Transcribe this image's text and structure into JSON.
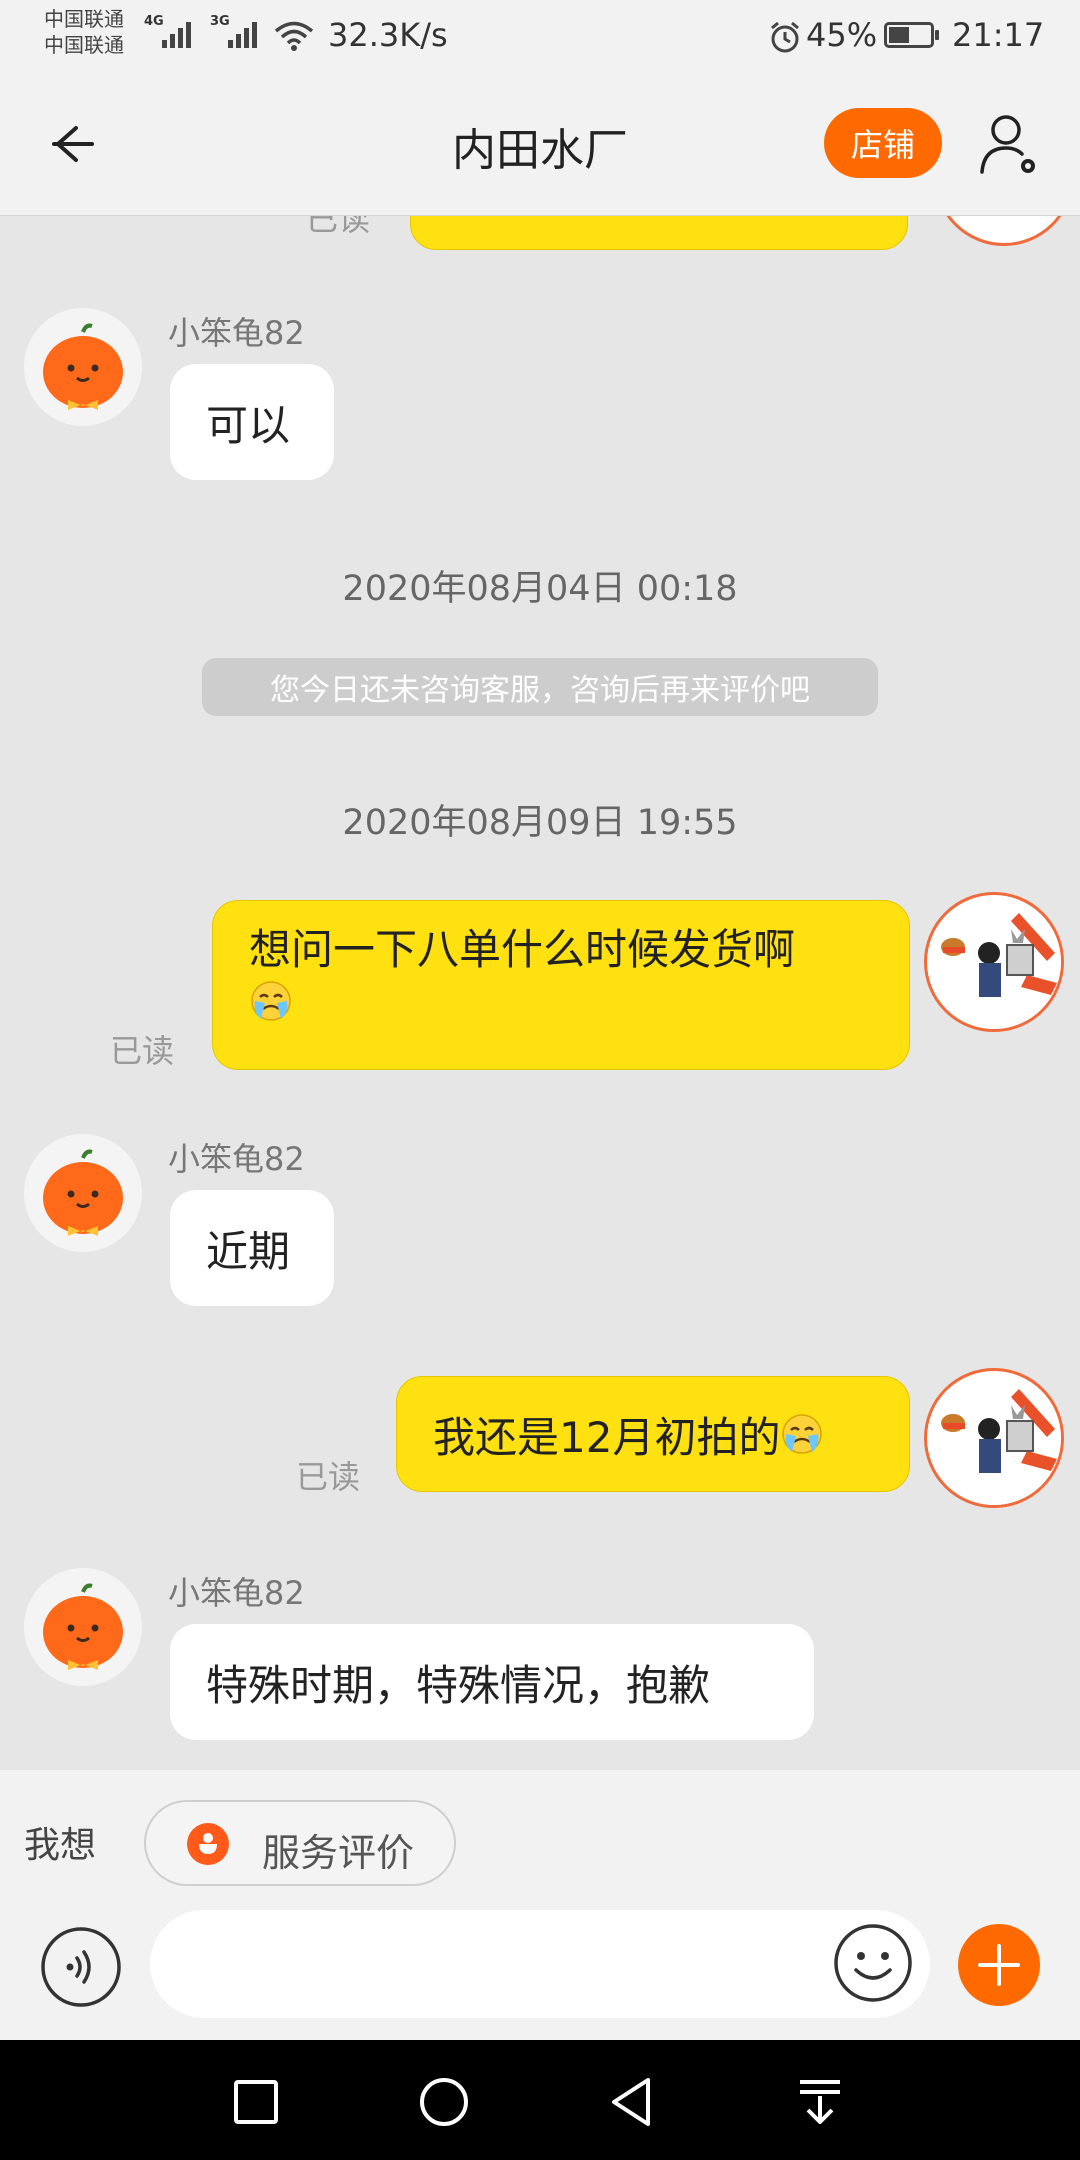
{
  "status_bar": {
    "carrier_1": "中国联通",
    "carrier_2": "中国联通",
    "net_1": "4G",
    "net_2": "3G",
    "speed": "32.3K/s",
    "battery_percent": "45%",
    "battery_level": 0.45,
    "time": "21:17",
    "icons": [
      "signal-icon",
      "wifi-icon",
      "alarm-icon",
      "battery-icon"
    ]
  },
  "header": {
    "title": "内田水厂",
    "shop_label": "店铺",
    "back_icon": "back-arrow-icon",
    "user_icon": "user-settings-icon"
  },
  "chat": {
    "partial_top": {
      "read_label": "已读"
    },
    "messages": [
      {
        "type": "incoming",
        "sender": "小笨龟82",
        "text": "可以"
      },
      {
        "type": "timestamp",
        "text": "2020年08月04日 00:18"
      },
      {
        "type": "notice",
        "text": "您今日还未咨询客服，咨询后再来评价吧"
      },
      {
        "type": "timestamp",
        "text": "2020年08月09日 19:55"
      },
      {
        "type": "outgoing",
        "line1": "想问一下八单什么时候发货啊",
        "emoji": "crying-emoji",
        "read": "已读"
      },
      {
        "type": "incoming",
        "sender": "小笨龟82",
        "text": "近期"
      },
      {
        "type": "outgoing",
        "text": "我还是12月初拍的",
        "emoji": "crying-emoji",
        "read": "已读"
      },
      {
        "type": "incoming",
        "sender": "小笨龟82",
        "text": "特殊时期，特殊情况，抱歉"
      }
    ]
  },
  "quick_reply": {
    "label": "我想",
    "chip_label": "服务评价",
    "chip_icon": "rating-icon"
  },
  "input": {
    "value": "",
    "placeholder": "",
    "voice_icon": "voice-icon",
    "emoji_icon": "emoji-icon",
    "plus_icon": "plus-icon"
  },
  "nav_bar": {
    "icons": [
      "recent-apps-icon",
      "home-icon",
      "back-icon",
      "notification-pull-icon"
    ]
  },
  "colors": {
    "accent": "#ff6a00",
    "outgoing_bubble": "#ffe010",
    "incoming_bubble": "#ffffff",
    "chat_bg": "#e6e6e6"
  }
}
